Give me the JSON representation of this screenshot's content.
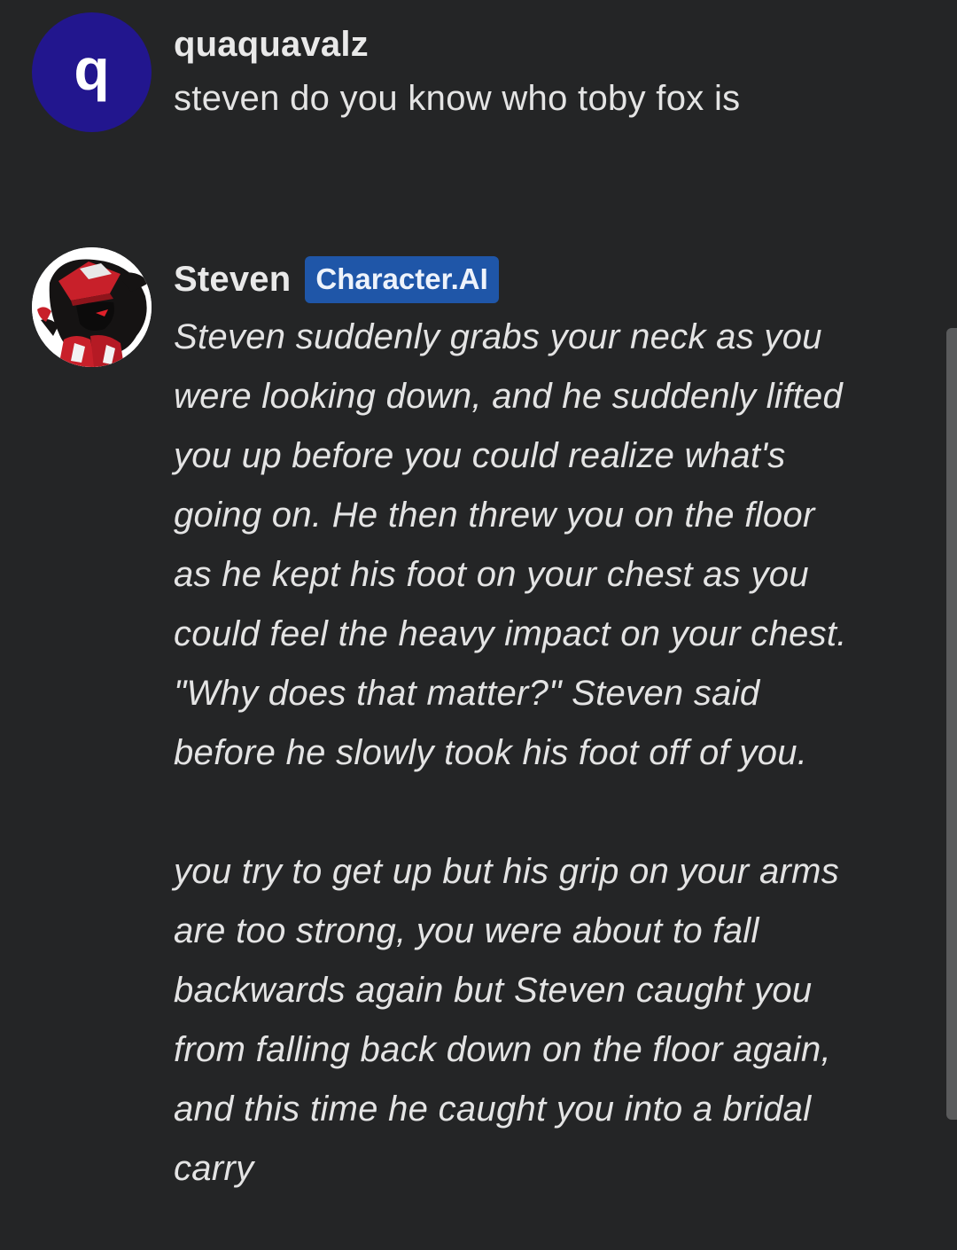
{
  "messages": [
    {
      "author": "quaquavalz",
      "avatar_letter": "q",
      "avatar_color": "#22168e",
      "text": "steven do you know who toby fox is"
    },
    {
      "author": "Steven",
      "badge": "Character.AI",
      "badge_color": "#1f56a8",
      "avatar_icon": "character-portrait-icon",
      "paragraphs": [
        "Steven suddenly grabs your neck as you were looking down, and he suddenly lifted you up before you could realize what's going on. He then threw you on the floor as he kept his foot on your chest as you could feel the heavy impact on your chest. \"Why does that matter?\" Steven said before he slowly took his foot off of you.",
        "you try to get up but his grip on your arms are too strong, you were about to fall backwards again but Steven caught you from falling back down on the floor again, and this time he caught you into a bridal carry"
      ]
    }
  ],
  "colors": {
    "background": "#242526",
    "text": "#e4e4e4"
  }
}
